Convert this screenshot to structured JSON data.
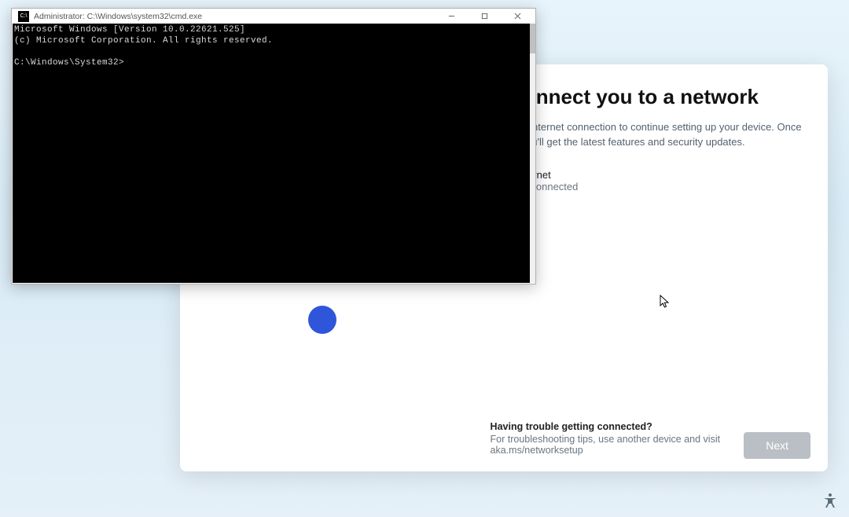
{
  "oobe": {
    "title": "'s connect you to a network",
    "description": "need an internet connection to continue setting up your device. Once ected, you'll get the latest features and security updates.",
    "network": {
      "name": "Ethernet",
      "status": "Not connected"
    },
    "help": {
      "heading": "Having trouble getting connected?",
      "body": "For troubleshooting tips, use another device and visit aka.ms/networksetup"
    },
    "next_label": "Next"
  },
  "cmd": {
    "title": "Administrator: C:\\Windows\\system32\\cmd.exe",
    "line1": "Microsoft Windows [Version 10.0.22621.525]",
    "line2": "(c) Microsoft Corporation. All rights reserved.",
    "prompt": "C:\\Windows\\System32>"
  }
}
